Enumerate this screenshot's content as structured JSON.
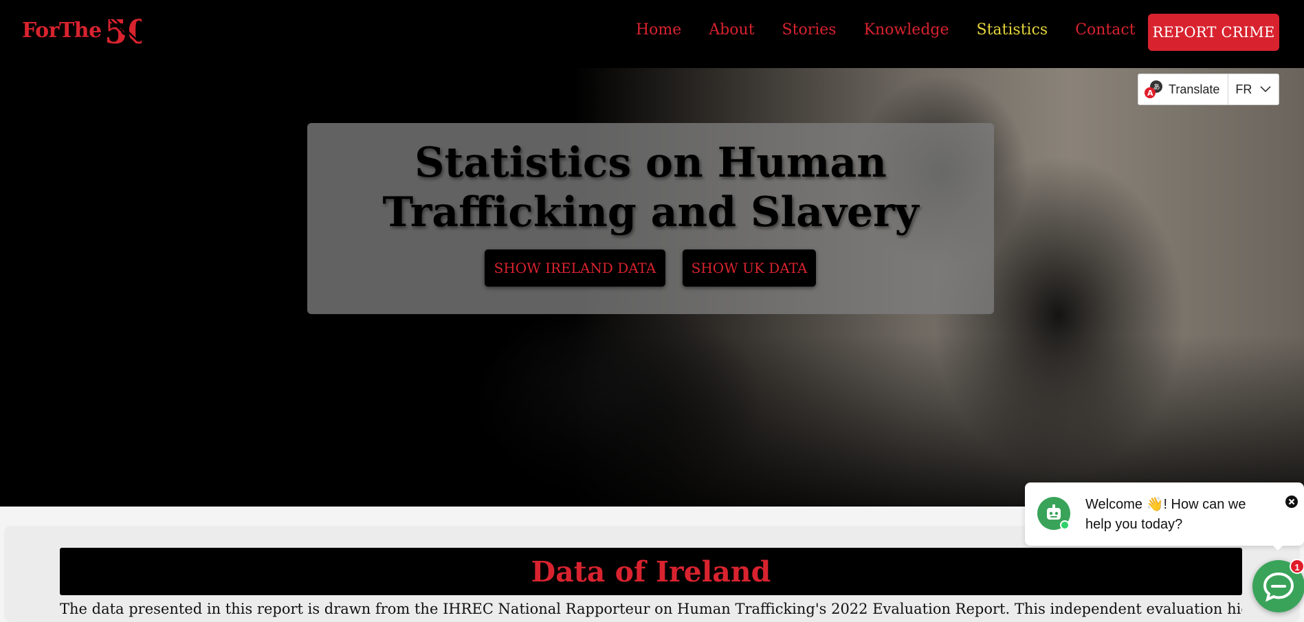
{
  "brand": {
    "logo_text": "ForThe",
    "logo_number": "50"
  },
  "nav": {
    "items": [
      {
        "label": "Home"
      },
      {
        "label": "About"
      },
      {
        "label": "Stories"
      },
      {
        "label": "Knowledge"
      },
      {
        "label": "Statistics",
        "active": true
      },
      {
        "label": "Contact"
      }
    ],
    "report_label": "REPORT CRIME"
  },
  "translate": {
    "label": "Translate",
    "language": "FR"
  },
  "hero": {
    "title": "Statistics on Human Trafficking and Slavery",
    "ireland_button": "SHOW IRELAND DATA",
    "uk_button": "SHOW UK DATA"
  },
  "content": {
    "section_title": "Data of Ireland",
    "intro": "The data presented in this report is drawn from the IHREC National Rapporteur on Human Trafficking's 2022 Evaluation Report. This independent evaluation highlights"
  },
  "chat": {
    "welcome": "Welcome 👋! How can we help you today?",
    "unread_count": "1"
  },
  "colors": {
    "brand_red": "#d8232f",
    "active_nav": "#e5d53b",
    "chat_green": "#3aa35a"
  }
}
